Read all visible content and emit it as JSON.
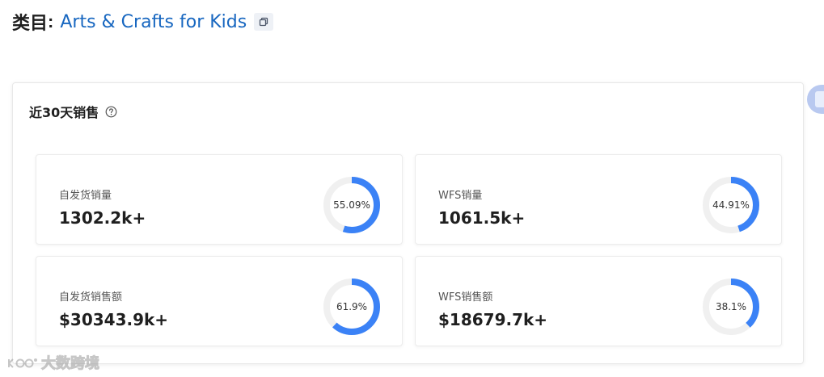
{
  "header": {
    "prefix": "类目",
    "separator": ":",
    "category_name": "Arts & Crafts for Kids",
    "copy_icon": "copy-icon"
  },
  "panel": {
    "title": "近30天销售",
    "help_icon": "question-circle-icon"
  },
  "cards": [
    {
      "label": "自发货销量",
      "value": "1302.2k+",
      "percent_label": "55.09%",
      "percent": 55.09
    },
    {
      "label": "WFS销量",
      "value": "1061.5k+",
      "percent_label": "44.91%",
      "percent": 44.91
    },
    {
      "label": "自发货销售额",
      "value": "$30343.9k+",
      "percent_label": "61.9%",
      "percent": 61.9
    },
    {
      "label": "WFS销售额",
      "value": "$18679.7k+",
      "percent_label": "38.1%",
      "percent": 38.1
    }
  ],
  "colors": {
    "accent": "#3b82f6",
    "track": "#f0f0f0",
    "link": "#1867c0"
  },
  "watermark": {
    "text": "大数跨境"
  },
  "side_tab": {
    "icon": "side-panel-icon"
  }
}
